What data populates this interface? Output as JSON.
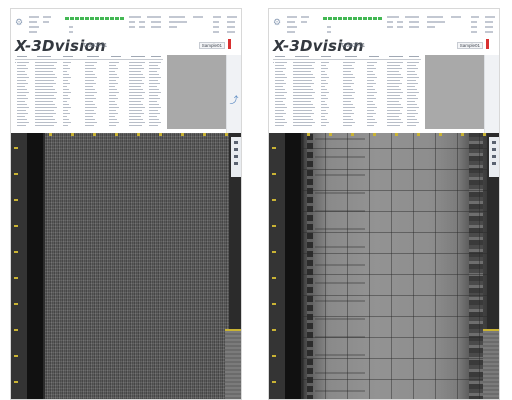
{
  "panels": [
    {
      "brand": "X-3Dvision",
      "code": "T22808-01",
      "sample_button": "Sample01",
      "led_count": 12
    },
    {
      "brand": "X-3Dvision",
      "code": "T22808-01",
      "sample_button": "Sample01",
      "led_count": 12
    }
  ],
  "colors": {
    "led_green": "#43b853",
    "flag_red": "#d83030",
    "tick_yellow": "#c9b334",
    "header_gray": "#a9a9a9"
  },
  "icons": {
    "settings": "gear-icon",
    "trend": "trend-chart-icon"
  }
}
